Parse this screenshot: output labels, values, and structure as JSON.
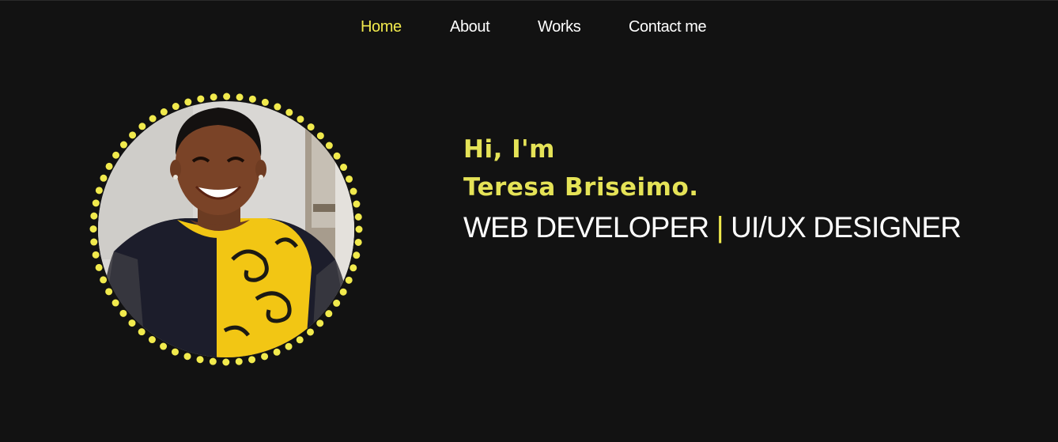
{
  "nav": {
    "items": [
      {
        "label": "Home",
        "active": true
      },
      {
        "label": "About",
        "active": false
      },
      {
        "label": "Works",
        "active": false
      },
      {
        "label": "Contact me",
        "active": false
      }
    ]
  },
  "hero": {
    "greeting": "Hi, I'm",
    "name": "Teresa Briseimo.",
    "role_1": "WEB DEVELOPER",
    "separator": "|",
    "role_2": "UI/UX DESIGNER"
  },
  "colors": {
    "background": "#121212",
    "accent": "#f1ea4d",
    "text": "#ffffff"
  },
  "avatar": {
    "ring_style": "dotted-yellow",
    "icon": "profile-photo"
  }
}
